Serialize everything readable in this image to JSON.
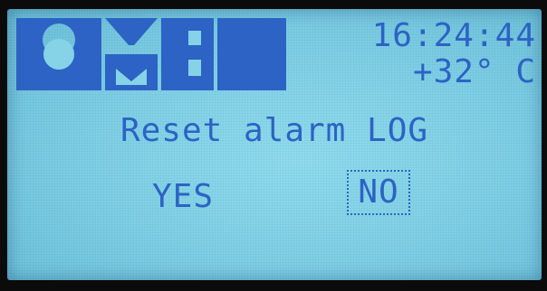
{
  "brand": {
    "logo": "OMB"
  },
  "status": {
    "time": "16:24:44",
    "temperature": "+32° C"
  },
  "dialog": {
    "message": "Reset alarm LOG",
    "options": {
      "yes": "YES",
      "no": "NO"
    },
    "selected": "NO"
  },
  "colors": {
    "screen_background": "#7ccde3",
    "lcd_ink": "#2c63c4"
  }
}
